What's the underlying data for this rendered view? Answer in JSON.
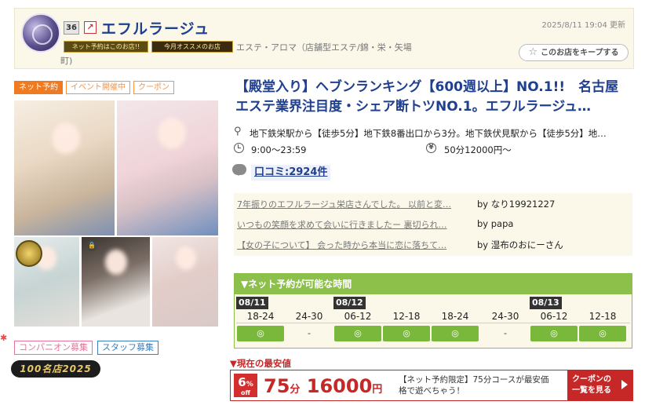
{
  "header": {
    "rank": "36",
    "shop_name": "エフルラージュ",
    "updated": "2025/8/11 19:04 更新",
    "banner_reservation": "ネット予約はこのお店!!",
    "banner_recommend": "今月オススメのお店",
    "category_line1": "エステ・アロマ（店舗型エステ/錦・栄・矢場",
    "category_line2": "町)",
    "keep_label": "このお店をキープする"
  },
  "tags": [
    "ネット予約",
    "イベント開催中",
    "クーポン"
  ],
  "recruit": {
    "companion": "コンパニオン募集",
    "staff": "スタッフ募集",
    "award": "100名店2025"
  },
  "info": {
    "headline": "【殿堂入り】ヘブンランキング【600週以上】NO.1!!　名古屋エステ業界注目度・シェア断トツNO.1。エフルラージュ…",
    "access": "地下鉄栄駅から【徒歩5分】地下鉄8番出口から3分。地下鉄伏見駅から【徒歩5分】地…",
    "hours": "9:00〜23:59",
    "price": "50分12000円〜",
    "review_count": "口コミ:2924件"
  },
  "reviews": [
    {
      "text": "7年振りのエフルラージュ栄店さんでした。 以前と変…",
      "by": "by なり19921227"
    },
    {
      "text": "いつもの笑顔を求めて会いに行きましたー 裏切られ…",
      "by": "by papa"
    },
    {
      "text": "【女の子について】 会った時から本当に恋に落ちて…",
      "by": "by 湿布のおにーさん"
    }
  ],
  "availability": {
    "title": "▼ネット予約が可能な時間",
    "dates": [
      "08/11",
      "08/12",
      "08/13"
    ],
    "slots": [
      {
        "label": "18-24",
        "status": "◎"
      },
      {
        "label": "24-30",
        "status": "-"
      },
      {
        "label": "06-12",
        "status": "◎"
      },
      {
        "label": "12-18",
        "status": "◎"
      },
      {
        "label": "18-24",
        "status": "◎"
      },
      {
        "label": "24-30",
        "status": "-"
      },
      {
        "label": "06-12",
        "status": "◎"
      },
      {
        "label": "12-18",
        "status": "◎"
      }
    ]
  },
  "lowest": {
    "label": "▼現在の最安値",
    "off_value": "6",
    "off_unit": "%",
    "off_text": "off",
    "minutes": "75",
    "minutes_unit": "分",
    "amount": "16000",
    "amount_unit": "円",
    "note": "【ネット予約限定】75分コースが最安価格で遊べちゃう！",
    "coupon_line1": "クーポンの",
    "coupon_line2": "一覧を見る"
  },
  "icons": [
    "logo",
    "rank-badge",
    "external-link-icon",
    "star-icon",
    "pin-icon",
    "clock-icon",
    "yen-icon",
    "chat-icon",
    "lock-icon",
    "arrow-right-icon"
  ],
  "colors": {
    "brand_blue": "#1f3f8f",
    "orange": "#f07a1f",
    "green": "#8cc04a",
    "red": "#c62828"
  }
}
